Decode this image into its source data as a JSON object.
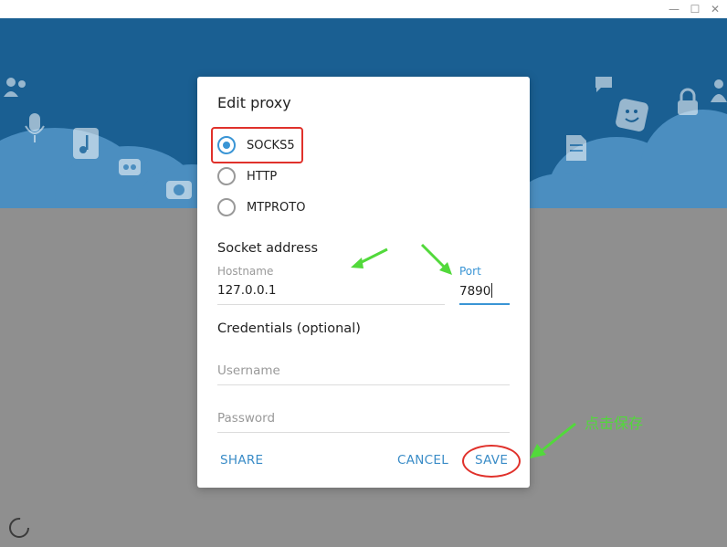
{
  "window": {
    "minimize_glyph": "—",
    "maximize_glyph": "☐",
    "close_glyph": "✕"
  },
  "dialog": {
    "title": "Edit proxy",
    "proxy_types": [
      {
        "label": "SOCKS5",
        "selected": true
      },
      {
        "label": "HTTP",
        "selected": false
      },
      {
        "label": "MTPROTO",
        "selected": false
      }
    ],
    "socket_section": "Socket address",
    "hostname": {
      "label": "Hostname",
      "value": "127.0.0.1"
    },
    "port": {
      "label": "Port",
      "value": "7890"
    },
    "credentials_section": "Credentials (optional)",
    "username": {
      "placeholder": "Username",
      "value": ""
    },
    "password": {
      "placeholder": "Password",
      "value": ""
    },
    "share_label": "SHARE",
    "cancel_label": "CANCEL",
    "save_label": "SAVE"
  },
  "annotation": {
    "save_hint": "点击保存"
  },
  "colors": {
    "accent": "#3a95d5",
    "banner": "#1a5f92",
    "annotation_red": "#e0312b",
    "annotation_green": "#52d93b"
  }
}
